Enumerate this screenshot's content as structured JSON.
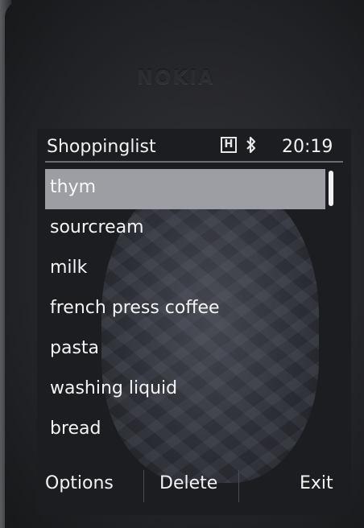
{
  "device": {
    "brand": "NOKIA"
  },
  "status_bar": {
    "title": "Shoppinglist",
    "network_indicator": "H",
    "bluetooth_icon": "bluetooth-icon",
    "time": "20:19"
  },
  "list": {
    "selected_index": 0,
    "items": [
      {
        "label": "thym"
      },
      {
        "label": "sourcream"
      },
      {
        "label": "milk"
      },
      {
        "label": "french press coffee"
      },
      {
        "label": "pasta"
      },
      {
        "label": "washing liquid"
      },
      {
        "label": "bread"
      }
    ]
  },
  "softkeys": {
    "left": "Options",
    "middle": "Delete",
    "right": "Exit"
  },
  "colors": {
    "selection_bg": "#9c9ea3",
    "text": "#f4f4f4",
    "screen_bg": "#1c1d21"
  }
}
